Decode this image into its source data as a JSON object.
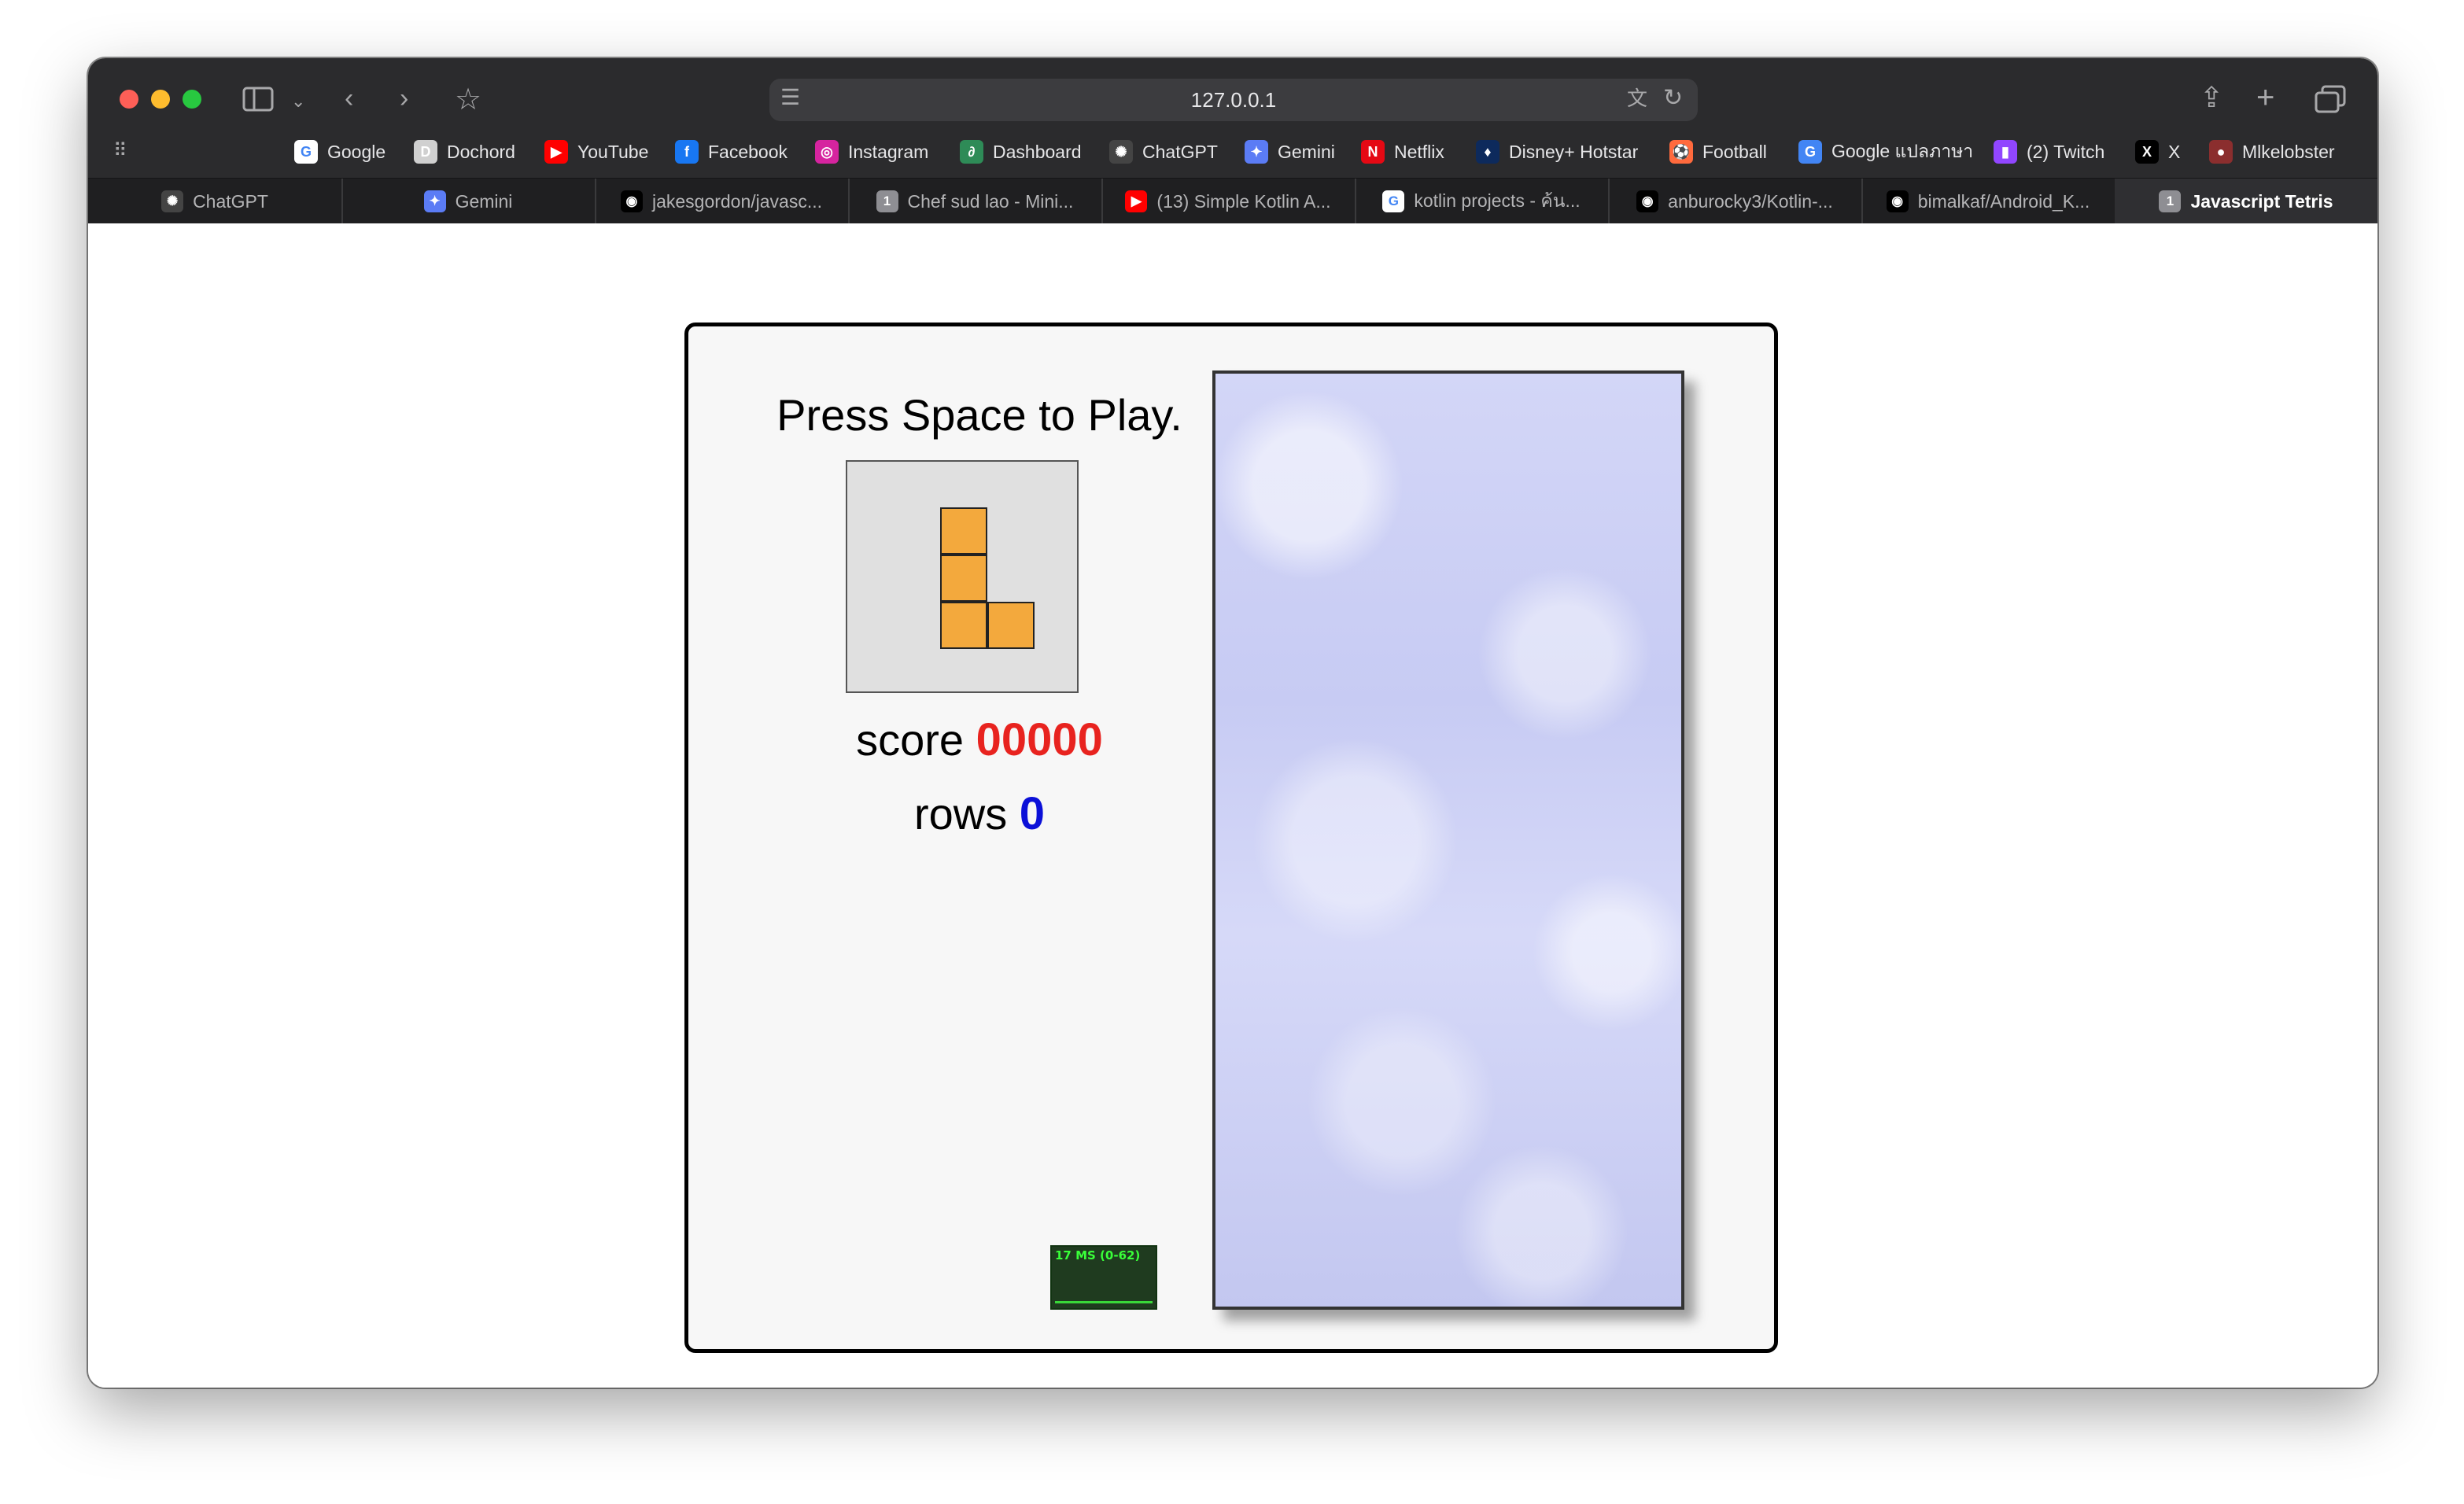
{
  "browser": {
    "url": "127.0.0.1",
    "bookmarks": [
      {
        "label": "Google",
        "icon": "google-icon",
        "color": "#ffffff"
      },
      {
        "label": "Dochord",
        "icon": "dochord-icon",
        "color": "#d0d0d0"
      },
      {
        "label": "YouTube",
        "icon": "youtube-icon",
        "color": "#ff0000"
      },
      {
        "label": "Facebook",
        "icon": "facebook-icon",
        "color": "#1877f2"
      },
      {
        "label": "Instagram",
        "icon": "instagram-icon",
        "color": "#d6249f"
      },
      {
        "label": "Dashboard",
        "icon": "dashboard-icon",
        "color": "#2e8b57"
      },
      {
        "label": "ChatGPT",
        "icon": "chatgpt-icon",
        "color": "#444444"
      },
      {
        "label": "Gemini",
        "icon": "gemini-icon",
        "color": "#5b7cf5"
      },
      {
        "label": "Netflix",
        "icon": "netflix-icon",
        "color": "#e50914"
      },
      {
        "label": "Disney+ Hotstar",
        "icon": "hotstar-icon",
        "color": "#0d2a5c"
      },
      {
        "label": "Football",
        "icon": "football-icon",
        "color": "#ff6a3d"
      },
      {
        "label": "Google แปลภาษา",
        "icon": "google-translate-icon",
        "color": "#4285f4"
      },
      {
        "label": "(2) Twitch",
        "icon": "twitch-icon",
        "color": "#9146ff"
      },
      {
        "label": "X",
        "icon": "x-icon",
        "color": "#000000"
      },
      {
        "label": "Mlkelobster",
        "icon": "mlkelobster-icon",
        "color": "#8b2e2e"
      }
    ],
    "tabs": [
      {
        "label": "ChatGPT",
        "icon": "chatgpt-icon",
        "color": "#444444"
      },
      {
        "label": "Gemini",
        "icon": "gemini-icon",
        "color": "#5b7cf5"
      },
      {
        "label": "jakesgordon/javasc...",
        "icon": "github-icon",
        "color": "#000000"
      },
      {
        "label": "Chef sud lao - Mini...",
        "icon": "tab-badge-icon",
        "color": "#8e8e93"
      },
      {
        "label": "(13) Simple Kotlin A...",
        "icon": "youtube-icon",
        "color": "#ff0000"
      },
      {
        "label": "kotlin projects - ค้น...",
        "icon": "google-icon",
        "color": "#ffffff"
      },
      {
        "label": "anburocky3/Kotlin-...",
        "icon": "github-icon",
        "color": "#000000"
      },
      {
        "label": "bimalkaf/Android_K...",
        "icon": "github-icon",
        "color": "#000000"
      },
      {
        "label": "Javascript Tetris",
        "icon": "tab-badge-icon",
        "color": "#8e8e93",
        "active": true
      }
    ]
  },
  "game": {
    "message": "Press Space to Play.",
    "score_label": "score",
    "score_value": "00000",
    "rows_label": "rows",
    "rows_value": "0",
    "fps_label": "17 MS (0-62)",
    "next_piece": "L",
    "piece_color": "#f3a93d",
    "score_color": "#e8231f",
    "rows_color": "#0b10d8"
  }
}
